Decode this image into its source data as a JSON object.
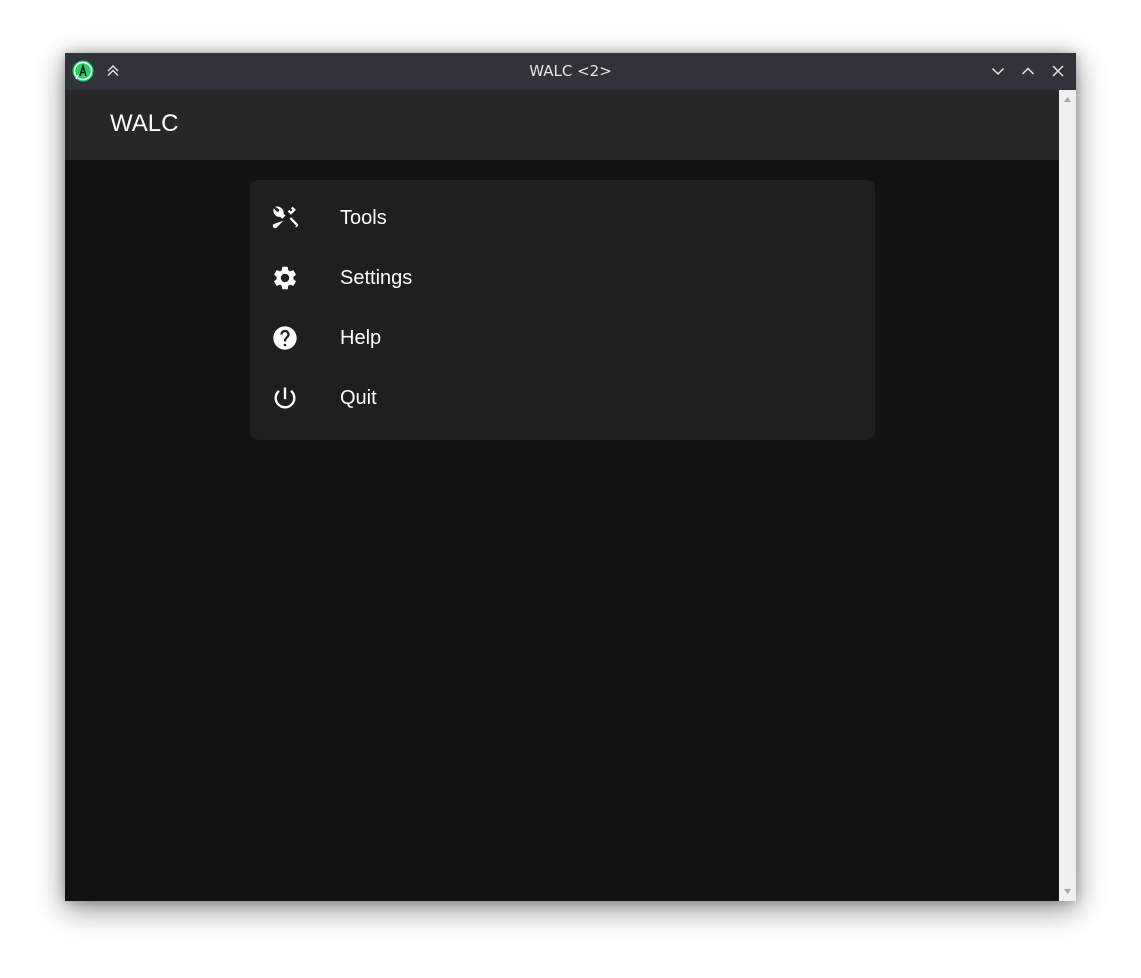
{
  "window": {
    "title": "WALC <2>"
  },
  "titlebar_icons": {
    "app": "whatsapp-icon",
    "keep_above": "keep-above-icon",
    "minimize": "chevron-down-icon",
    "maximize": "chevron-up-icon",
    "close": "close-icon"
  },
  "appbar": {
    "title": "WALC"
  },
  "menu": {
    "items": [
      {
        "label": "Tools",
        "icon": "tools-icon"
      },
      {
        "label": "Settings",
        "icon": "gear-icon"
      },
      {
        "label": "Help",
        "icon": "help-icon"
      },
      {
        "label": "Quit",
        "icon": "power-icon"
      }
    ]
  },
  "colors": {
    "titlebar": "#30343a",
    "appbar": "#272727",
    "background": "#121212",
    "menu_card": "#1f1f1f",
    "app_icon_green": "#25d366"
  }
}
